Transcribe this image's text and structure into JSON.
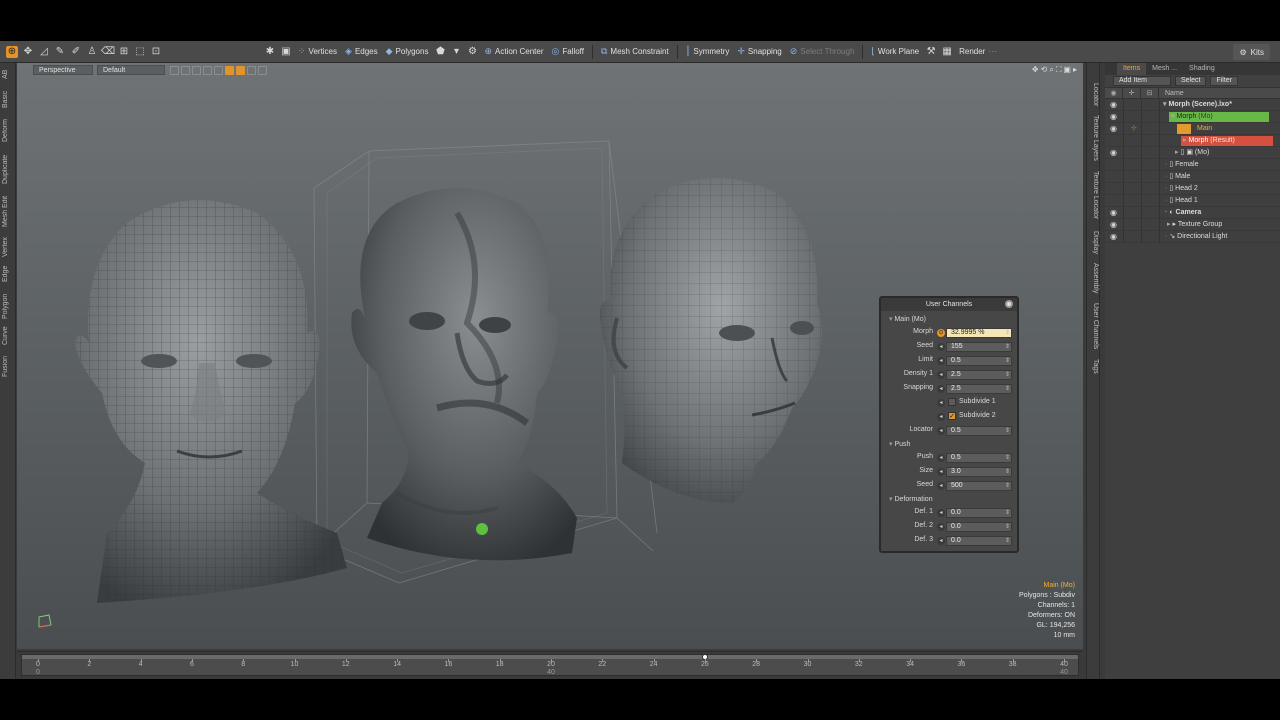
{
  "toolbar": {
    "vertices": "Vertices",
    "edges": "Edges",
    "polygons": "Polygons",
    "action_center": "Action Center",
    "falloff": "Falloff",
    "mesh_constraint": "Mesh Constraint",
    "symmetry": "Symmetry",
    "snapping": "Snapping",
    "select_through": "Select Through",
    "work_plane": "Work Plane",
    "render": "Render",
    "kits": "Kits"
  },
  "left_tabs": [
    "AB",
    "Basic",
    "Deform",
    "Duplicate",
    "Mesh Edit",
    "Vertex",
    "Edge",
    "Polygon",
    "Curve",
    "Fusion"
  ],
  "viewport": {
    "view_mode": "Perspective",
    "shading": "Default"
  },
  "info_overlay": {
    "item": "Main (Mo)",
    "polygons": "Polygons : Subdiv",
    "channels": "Channels: 1",
    "deformers": "Deformers: ON",
    "gl": "GL: 194,256",
    "scale": "10 mm"
  },
  "user_channels": {
    "title": "User Channels",
    "group_main": "Main (Mo)",
    "group_push": "Push",
    "group_deformation": "Deformation",
    "morph_label": "Morph",
    "morph_value": "32.9995 %",
    "seed_label": "Seed",
    "seed_value": "155",
    "limit_label": "Limit",
    "limit_value": "0.5",
    "density_label": "Density 1",
    "density_value": "2.5",
    "snapping_label": "Snapping",
    "snapping_value": "2.5",
    "subdivide1_label": "Subdivide 1",
    "subdivide2_label": "Subdivide 2",
    "locator_label": "Locator",
    "locator_value": "0.5",
    "push_label": "Push",
    "push_value": "0.5",
    "size_label": "Size",
    "size_value": "3.0",
    "seed2_label": "Seed",
    "seed2_value": "500",
    "def1_label": "Def. 1",
    "def1_value": "0.0",
    "def2_label": "Def. 2",
    "def2_value": "0.0",
    "def3_label": "Def. 3",
    "def3_value": "0.0"
  },
  "right_tabs": [
    "Locator",
    "Texture Layers",
    "Texture Locator",
    "Display",
    "Assembly",
    "User Channels",
    "Tags"
  ],
  "items_panel": {
    "tabs": [
      "Items",
      "Mesh ...",
      "Shading"
    ],
    "add_item": "Add Item",
    "select": "Select",
    "filter": "Filter",
    "name_header": "Name",
    "rows": [
      {
        "label": "Morph (Scene).lxo*",
        "suffix": ""
      },
      {
        "label": "Morph",
        "suffix": " (Mo)"
      },
      {
        "label": "Main",
        "suffix": ""
      },
      {
        "label": "Morph",
        "suffix": " (Result)"
      },
      {
        "label": "(Mo)",
        "suffix": ""
      },
      {
        "label": "Female",
        "suffix": ""
      },
      {
        "label": "Male",
        "suffix": ""
      },
      {
        "label": "Head 2",
        "suffix": ""
      },
      {
        "label": "Head 1",
        "suffix": ""
      },
      {
        "label": "Camera",
        "suffix": ""
      },
      {
        "label": "Texture Group",
        "suffix": ""
      },
      {
        "label": "Directional Light",
        "suffix": ""
      }
    ]
  },
  "timeline": {
    "ticks": [
      "0",
      "2",
      "4",
      "6",
      "8",
      "10",
      "12",
      "14",
      "16",
      "18",
      "20",
      "22",
      "24",
      "26",
      "28",
      "30",
      "32",
      "34",
      "36",
      "38",
      "40"
    ],
    "start": "0",
    "mid": "40",
    "end": "40",
    "current_frame": 26
  },
  "colors": {
    "accent_orange": "#e0952c",
    "item_green": "#68b848",
    "item_red": "#d5503f"
  }
}
